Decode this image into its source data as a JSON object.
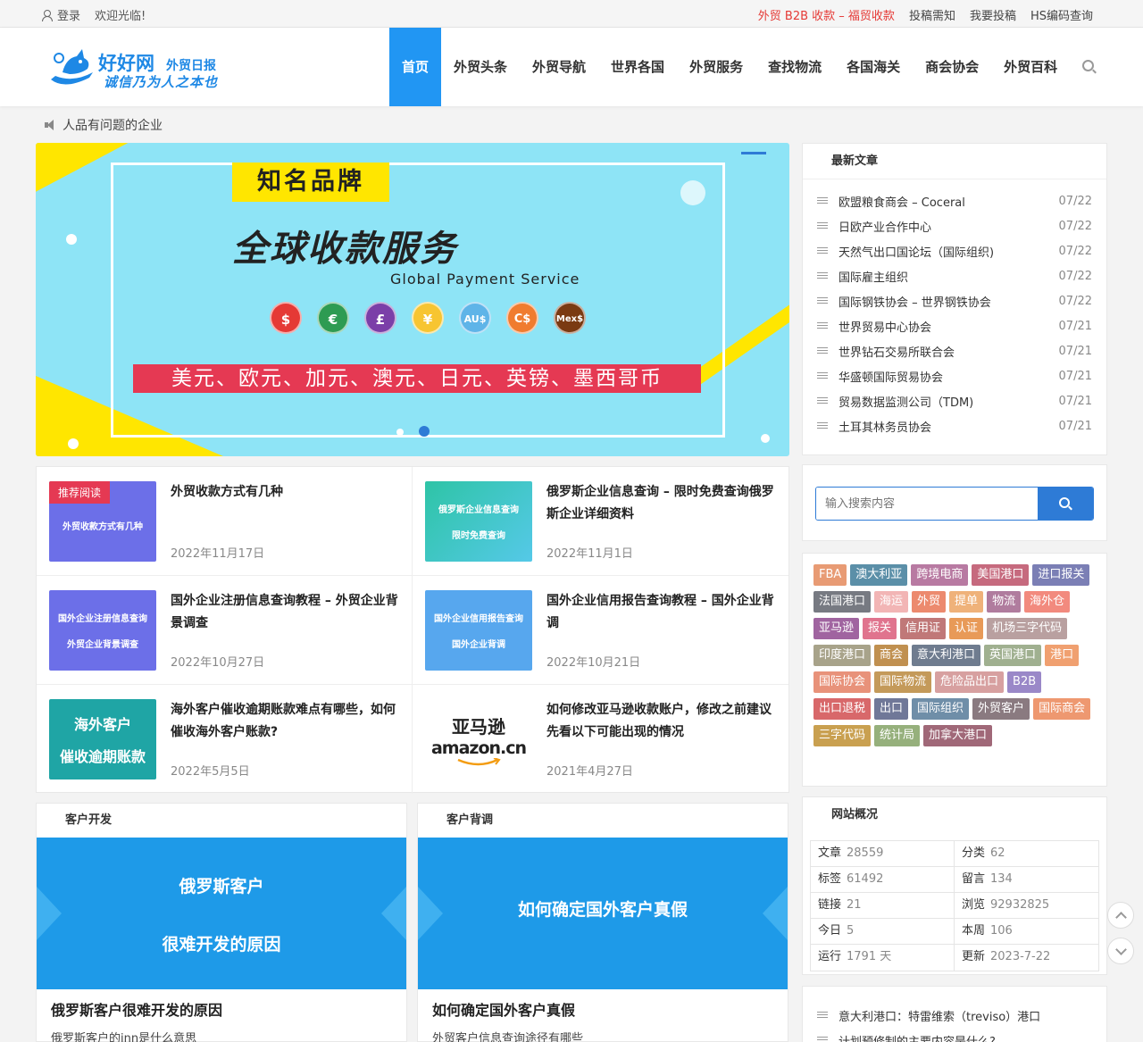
{
  "topbar": {
    "login": "登录",
    "welcome": "欢迎光临!",
    "links": [
      "外贸 B2B 收款 – 福贸收款",
      "投稿需知",
      "我要投稿",
      "HS编码查询"
    ]
  },
  "logo": {
    "name": "好好网",
    "tag": "外贸日报",
    "slogan": "诚信乃为人之本也"
  },
  "nav": [
    "首页",
    "外贸头条",
    "外贸导航",
    "世界各国",
    "外贸服务",
    "查找物流",
    "各国海关",
    "商会协会",
    "外贸百科"
  ],
  "notice": "人品有问题的企业",
  "banner": {
    "brand": "知名品牌",
    "title": "全球收款服务",
    "subtitle": "Global Payment  Service",
    "coins": [
      "$",
      "€",
      "£",
      "¥",
      "AU$",
      "C$",
      "Mex$"
    ],
    "currencies": "美元、欧元、加元、澳元、日元、英镑、墨西哥币"
  },
  "articles": [
    {
      "title": "外贸收款方式有几种",
      "date": "2022年11月17日",
      "thumb": [
        "外贸收款方式有几种"
      ],
      "badge": "推荐阅读"
    },
    {
      "title": "俄罗斯企业信息查询 – 限时免费查询俄罗斯企业详细资料",
      "date": "2022年11月1日",
      "thumb": [
        "俄罗斯企业信息查询",
        "限时免费查询"
      ]
    },
    {
      "title": "国外企业注册信息查询教程 – 外贸企业背景调查",
      "date": "2022年10月27日",
      "thumb": [
        "国外企业注册信息查询",
        "外贸企业背景调查"
      ]
    },
    {
      "title": "国外企业信用报告查询教程 – 国外企业背调",
      "date": "2022年10月21日",
      "thumb": [
        "国外企业信用报告查询",
        "国外企业背调"
      ]
    },
    {
      "title": "海外客户催收逾期账款难点有哪些，如何催收海外客户账款?",
      "date": "2022年5月5日",
      "thumb": [
        "海外客户",
        "催收逾期账款"
      ]
    },
    {
      "title": "如何修改亚马逊收款账户，修改之前建议先看以下可能出现的情况",
      "date": "2021年4月27日",
      "thumb": [
        "亚马逊",
        "amazon.cn"
      ]
    }
  ],
  "cards": [
    {
      "header": "客户开发",
      "img1": "俄罗斯客户",
      "img2": "很难开发的原因",
      "title": "俄罗斯客户很难开发的原因",
      "desc": "俄罗斯客户的inn是什么意思"
    },
    {
      "header": "客户背调",
      "img1": "如何确定国外客户真假",
      "img2": "",
      "title": "如何确定国外客户真假",
      "desc": "外贸客户信息查询途径有哪些"
    }
  ],
  "latest": {
    "title": "最新文章",
    "items": [
      {
        "t": "欧盟粮食商会 – Coceral",
        "d": "07/22"
      },
      {
        "t": "日欧产业合作中心",
        "d": "07/22"
      },
      {
        "t": "天然气出口国论坛（国际组织)",
        "d": "07/22"
      },
      {
        "t": "国际雇主组织",
        "d": "07/22"
      },
      {
        "t": "国际钢铁协会 – 世界钢铁协会",
        "d": "07/22"
      },
      {
        "t": "世界贸易中心协会",
        "d": "07/21"
      },
      {
        "t": "世界钻石交易所联合会",
        "d": "07/21"
      },
      {
        "t": "华盛顿国际贸易协会",
        "d": "07/21"
      },
      {
        "t": "贸易数据监测公司（TDM)",
        "d": "07/21"
      },
      {
        "t": "土耳其林务员协会",
        "d": "07/21"
      }
    ]
  },
  "search": {
    "placeholder": "输入搜索内容"
  },
  "tags": [
    {
      "t": "FBA",
      "c": "#e89b74"
    },
    {
      "t": "澳大利亚",
      "c": "#5b8fa8"
    },
    {
      "t": "跨境电商",
      "c": "#b87aa2"
    },
    {
      "t": "美国港口",
      "c": "#c66a7e"
    },
    {
      "t": "进口报关",
      "c": "#7b7fb5"
    },
    {
      "t": "法国港口",
      "c": "#777a82"
    },
    {
      "t": "海运",
      "c": "#f2b5b5"
    },
    {
      "t": "外贸",
      "c": "#ec8a6e"
    },
    {
      "t": "提单",
      "c": "#efb27a"
    },
    {
      "t": "物流",
      "c": "#b07c9e"
    },
    {
      "t": "海外仓",
      "c": "#f28a7e"
    },
    {
      "t": "亚马逊",
      "c": "#a064a0"
    },
    {
      "t": "报关",
      "c": "#e0748e"
    },
    {
      "t": "信用证",
      "c": "#c07878"
    },
    {
      "t": "认证",
      "c": "#e89a58"
    },
    {
      "t": "机场三字代码",
      "c": "#b9a0a0"
    },
    {
      "t": "印度港口",
      "c": "#a8a38a"
    },
    {
      "t": "商会",
      "c": "#c09050"
    },
    {
      "t": "意大利港口",
      "c": "#6f7c8f"
    },
    {
      "t": "英国港口",
      "c": "#a0b090"
    },
    {
      "t": "港口",
      "c": "#f0a070"
    },
    {
      "t": "国际协会",
      "c": "#e8927a"
    },
    {
      "t": "国际物流",
      "c": "#c49a5a"
    },
    {
      "t": "危险品出口",
      "c": "#d7a0a0"
    },
    {
      "t": "B2B",
      "c": "#9a88c8"
    },
    {
      "t": "出口退税",
      "c": "#d8686a"
    },
    {
      "t": "出口",
      "c": "#707898"
    },
    {
      "t": "国际组织",
      "c": "#6f8ea8"
    },
    {
      "t": "外贸客户",
      "c": "#8a7a80"
    },
    {
      "t": "国际商会",
      "c": "#ee9870"
    },
    {
      "t": "三字代码",
      "c": "#c9a050"
    },
    {
      "t": "统计局",
      "c": "#96b07c"
    },
    {
      "t": "加拿大港口",
      "c": "#a06878"
    }
  ],
  "stats": {
    "title": "网站概况",
    "rows": [
      [
        {
          "k": "文章",
          "v": "28559"
        },
        {
          "k": "分类",
          "v": "62"
        }
      ],
      [
        {
          "k": "标签",
          "v": "61492"
        },
        {
          "k": "留言",
          "v": "134"
        }
      ],
      [
        {
          "k": "链接",
          "v": "21"
        },
        {
          "k": "浏览",
          "v": "92932825"
        }
      ],
      [
        {
          "k": "今日",
          "v": "5"
        },
        {
          "k": "本周",
          "v": "106"
        }
      ],
      [
        {
          "k": "运行",
          "v": "1791 天"
        },
        {
          "k": "更新",
          "v": "2023-7-22"
        }
      ]
    ]
  },
  "more": [
    {
      "t": "意大利港口：特雷维索（treviso）港口"
    },
    {
      "t": "计划预修制的主要内容是什么?"
    }
  ]
}
